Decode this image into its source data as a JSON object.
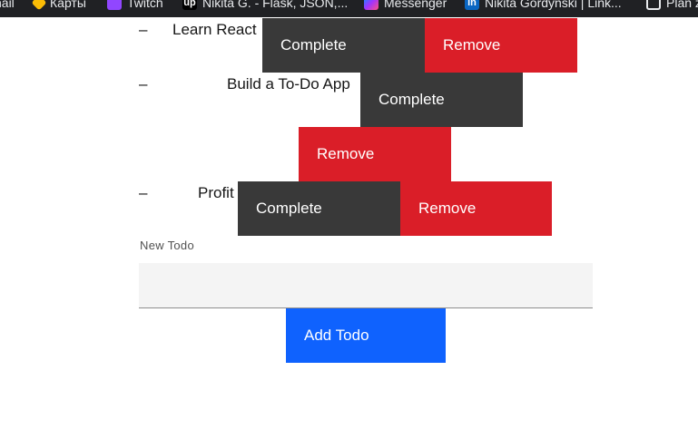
{
  "bookmarks": [
    {
      "label": "nail",
      "icon": "gmail-icon"
    },
    {
      "label": "Карты",
      "icon": "maps-icon"
    },
    {
      "label": "Twitch",
      "icon": "twitch-icon"
    },
    {
      "label": "Nikita G. - Flask, JSON,...",
      "icon": "upwork-icon"
    },
    {
      "label": "Messenger",
      "icon": "messenger-icon"
    },
    {
      "label": "Nikita Gordynski | Link...",
      "icon": "linkedin-icon"
    },
    {
      "label": "Plan z",
      "icon": "globe-icon"
    }
  ],
  "todos": [
    {
      "dash": "–",
      "text": "Learn React",
      "complete_label": "Complete",
      "remove_label": "Remove"
    },
    {
      "dash": "–",
      "text": "Build a To-Do App",
      "complete_label": "Complete",
      "remove_label": "Remove"
    },
    {
      "dash": "–",
      "text": "Profit",
      "complete_label": "Complete",
      "remove_label": "Remove"
    }
  ],
  "form": {
    "label": "New Todo",
    "value": "",
    "placeholder": "",
    "add_label": "Add Todo"
  },
  "colors": {
    "complete": "#393939",
    "remove": "#da1e28",
    "add": "#0f62fe",
    "input_bg": "#f4f4f4"
  }
}
